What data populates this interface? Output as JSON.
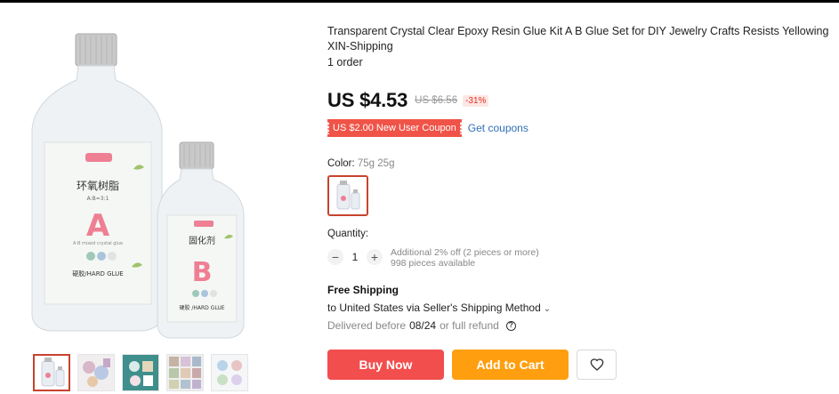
{
  "product": {
    "title": "Transparent Crystal Clear Epoxy Resin Glue Kit A B Glue Set for DIY Jewelry Crafts Resists Yellowing XIN-Shipping",
    "orders": "1 order",
    "price": "US $4.53",
    "original_price": "US $6.56",
    "discount": "-31%"
  },
  "coupon": {
    "label": "US $2.00 New User Coupon",
    "link": "Get coupons"
  },
  "color": {
    "label": "Color:",
    "value": "75g 25g"
  },
  "quantity": {
    "label": "Quantity:",
    "value": "1",
    "minus": "−",
    "plus": "+",
    "discount_note": "Additional 2% off (2 pieces or more)",
    "available": "998 pieces available"
  },
  "shipping": {
    "title": "Free Shipping",
    "method": "to United States via Seller's Shipping Method",
    "delivery_prefix": "Delivered before",
    "delivery_date": "08/24",
    "delivery_suffix": "or full refund"
  },
  "actions": {
    "buy_now": "Buy Now",
    "add_to_cart": "Add to Cart"
  },
  "bottle_labels": {
    "a_cn": "环氧树脂",
    "a_ratio": "A:B=3:1",
    "a_letter": "A",
    "a_small": "A·B mixed crystal glue",
    "a_en": "硬胶/HARD GLUE",
    "b_cn": "固化剂",
    "b_letter": "B",
    "b_en": "硬胶 /HARD GLUE"
  },
  "colors": {
    "accent": "#f24e4e",
    "cart": "#ff9f0f",
    "link": "#2f6fb8",
    "selected": "#c8432e",
    "label_pink": "#ef7f93"
  }
}
